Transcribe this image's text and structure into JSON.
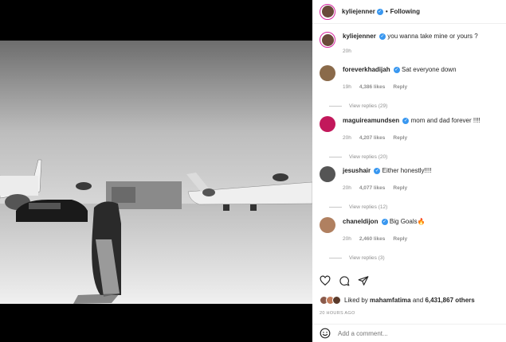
{
  "header": {
    "username": "kyliejenner",
    "follow_state": "Following"
  },
  "caption": {
    "username": "kyliejenner",
    "text": "you wanna take mine or yours ?",
    "time": "20h"
  },
  "comments": [
    {
      "username": "foreverkhadijah",
      "text": "Sat everyone down",
      "time": "19h",
      "likes": "4,386 likes",
      "reply": "Reply",
      "view_replies": "View replies (29)",
      "avatar_color": "#8a6a4a"
    },
    {
      "username": "maguireamundsen",
      "text": "mom and dad forever !!!!",
      "time": "20h",
      "likes": "4,207 likes",
      "reply": "Reply",
      "view_replies": "View replies (20)",
      "avatar_color": "#c2185b"
    },
    {
      "username": "jesushair",
      "text": "Either honestly!!!!",
      "time": "20h",
      "likes": "4,077 likes",
      "reply": "Reply",
      "view_replies": "View replies (12)",
      "avatar_color": "#555555"
    },
    {
      "username": "chaneldijon",
      "text": "Big Goals🔥",
      "time": "20h",
      "likes": "2,460 likes",
      "reply": "Reply",
      "view_replies": "View replies (3)",
      "avatar_color": "#b08060"
    }
  ],
  "likes": {
    "prefix": "Liked by",
    "user": "mahamfatima",
    "conj": "and",
    "count": "6,431,867 others"
  },
  "time_ago": "20 HOURS AGO",
  "add_comment": {
    "placeholder": "Add a comment..."
  },
  "colors": {
    "verified": "#3897f0",
    "story_ring": "#d6249f"
  }
}
